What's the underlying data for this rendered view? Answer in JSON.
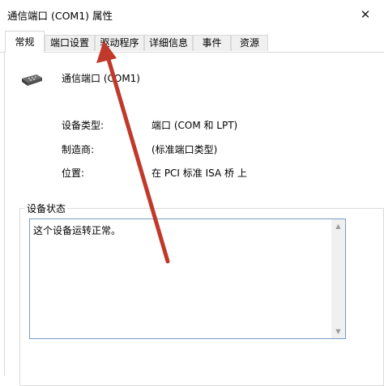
{
  "window": {
    "title": "通信端口 (COM1) 属性",
    "close_glyph": "✕"
  },
  "tabs": [
    {
      "label": "常规",
      "active": true
    },
    {
      "label": "端口设置",
      "active": false
    },
    {
      "label": "驱动程序",
      "active": false
    },
    {
      "label": "详细信息",
      "active": false
    },
    {
      "label": "事件",
      "active": false
    },
    {
      "label": "资源",
      "active": false
    }
  ],
  "device": {
    "icon": "serial-port-icon",
    "name": "通信端口 (COM1)"
  },
  "properties": [
    {
      "label": "设备类型:",
      "value": "端口 (COM 和 LPT)"
    },
    {
      "label": "制造商:",
      "value": "(标准端口类型)"
    },
    {
      "label": "位置:",
      "value": "在 PCI 标准 ISA 桥 上"
    }
  ],
  "status": {
    "group_label": "设备状态",
    "text": "这个设备运转正常。"
  },
  "annotation": {
    "color": "#c0392b"
  }
}
